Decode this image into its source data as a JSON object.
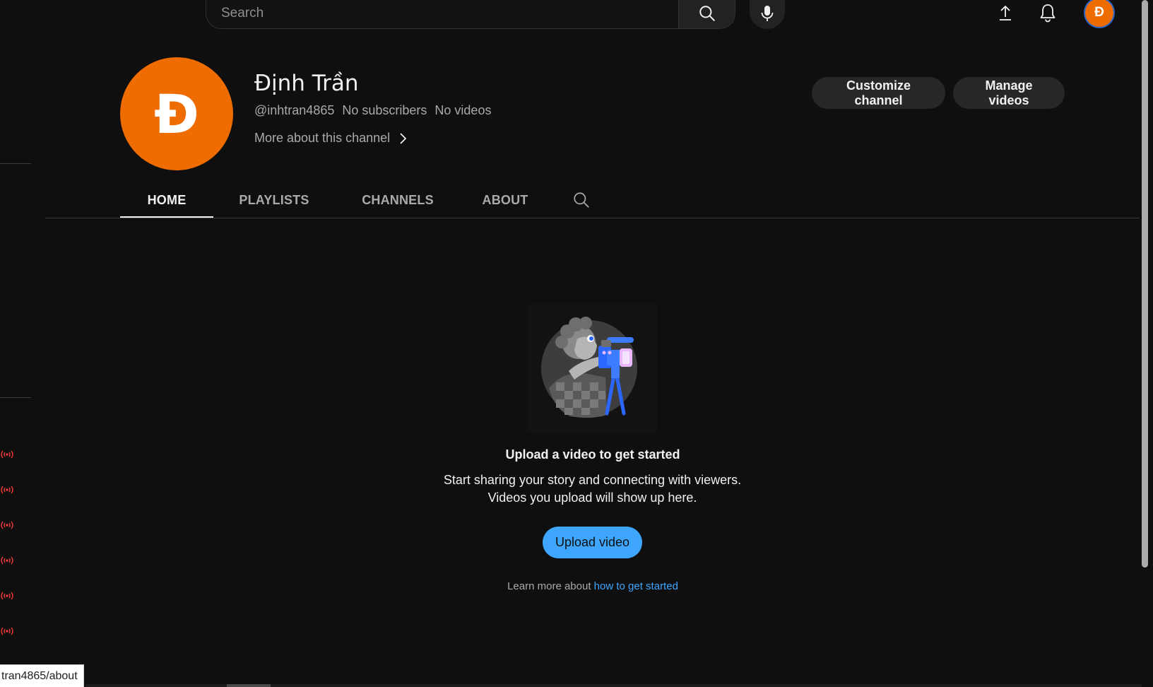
{
  "header": {
    "search_placeholder": "Search",
    "avatar_letter": "Đ"
  },
  "channel": {
    "avatar_letter": "Đ",
    "name": "Định Trần",
    "handle": "@inhtran4865",
    "subscribers": "No subscribers",
    "videos": "No videos",
    "more_about": "More about this channel",
    "customize_label": "Customize channel",
    "manage_label": "Manage videos"
  },
  "tabs": [
    {
      "label": "HOME",
      "active": true
    },
    {
      "label": "PLAYLISTS",
      "active": false
    },
    {
      "label": "CHANNELS",
      "active": false
    },
    {
      "label": "ABOUT",
      "active": false
    }
  ],
  "empty_state": {
    "title": "Upload a video to get started",
    "description": "Start sharing your story and connecting with viewers. Videos you upload will show up here.",
    "upload_label": "Upload video",
    "learn_prefix": "Learn more about",
    "learn_link": "how to get started"
  },
  "status_bar": {
    "url": "tran4865/about"
  },
  "colors": {
    "background": "#0f0f0f",
    "accent_orange": "#ef6c00",
    "link_blue": "#3ea6ff",
    "live_red": "#ff3b3b"
  },
  "icons": [
    "search-icon",
    "microphone-icon",
    "upload-icon",
    "bell-icon",
    "chevron-right-icon",
    "live-broadcast-icon"
  ]
}
